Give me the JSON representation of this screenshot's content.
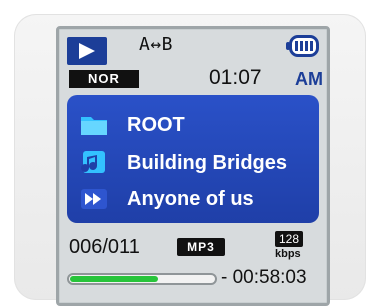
{
  "header": {
    "repeat_label": "A↔B",
    "eq_label": "NOR",
    "clock_time": "01:07",
    "clock_ampm": "AM",
    "battery_icon": "battery-icon",
    "play_icon": "play-icon"
  },
  "playlist": {
    "items": [
      {
        "icon": "folder-icon",
        "label": "ROOT"
      },
      {
        "icon": "music-note-icon",
        "label": "Building Bridges"
      },
      {
        "icon": "fast-forward-icon",
        "label": "Anyone of us"
      }
    ]
  },
  "status": {
    "track_counter": "006/011",
    "format": "MP3",
    "bitrate_value": "128",
    "bitrate_unit": "kbps",
    "remaining_time": "- 00:58:03",
    "progress": 0.6
  },
  "colors": {
    "accent": "#1c3e98",
    "list_bg": "#2442b8",
    "progress": "#27c43a"
  }
}
